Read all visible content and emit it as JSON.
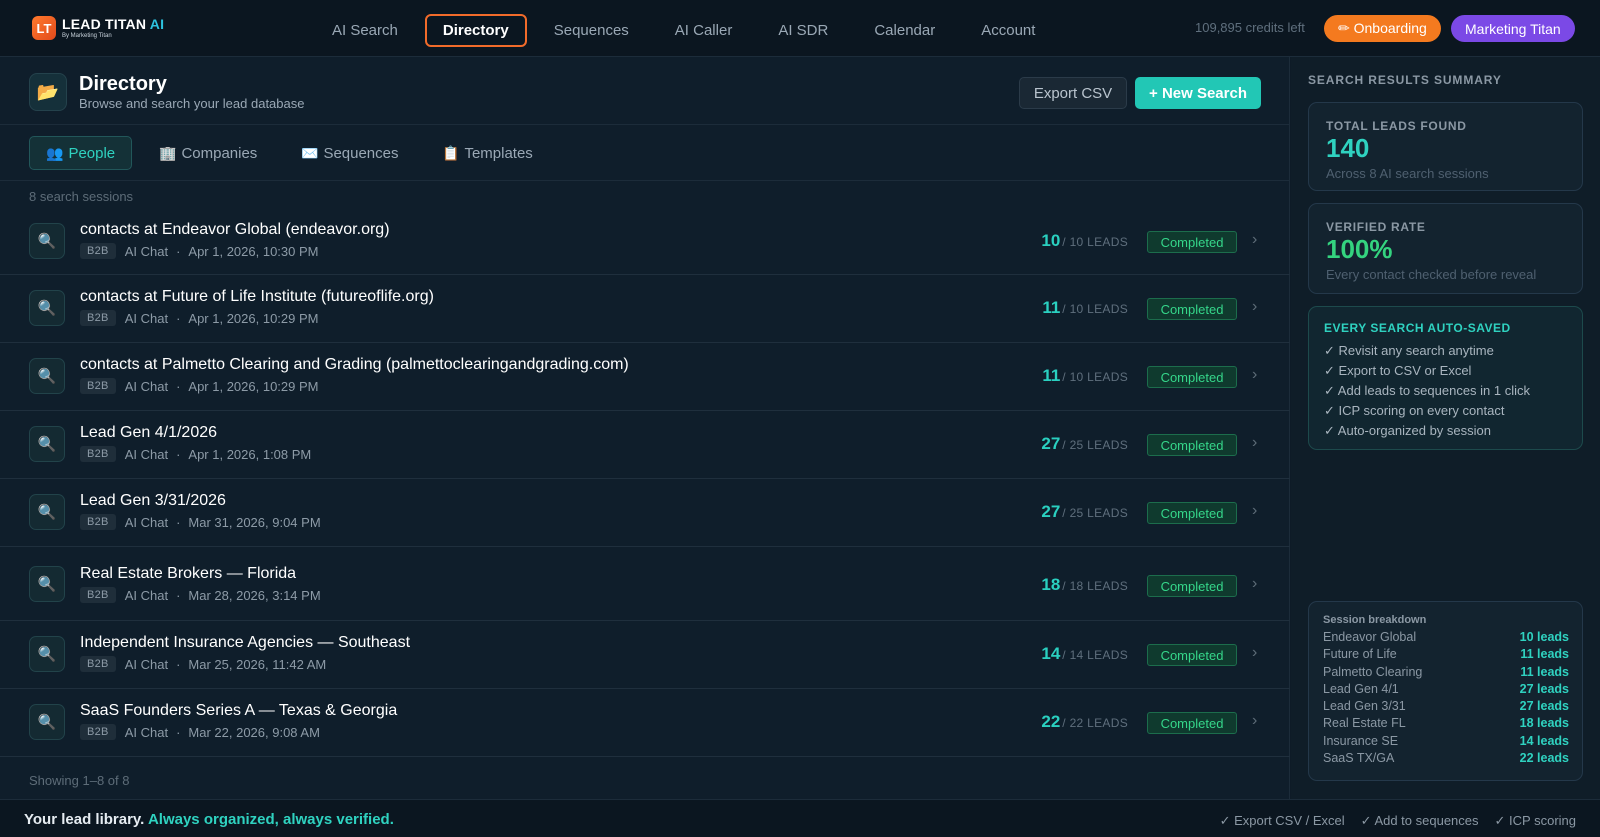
{
  "brand": {
    "logo_mark": "LT",
    "name_main": "LEAD TITAN",
    "name_accent": "AI",
    "tagline": "By Marketing Titan"
  },
  "nav": {
    "items": [
      {
        "label": "AI Search"
      },
      {
        "label": "Directory",
        "active": true
      },
      {
        "label": "Sequences"
      },
      {
        "label": "AI Caller"
      },
      {
        "label": "AI SDR"
      },
      {
        "label": "Calendar"
      },
      {
        "label": "Account"
      }
    ],
    "credits": "109,895 credits left",
    "onboarding_icon": "pencil-icon",
    "onboarding_label": "✏ Onboarding",
    "account_label": "Marketing Titan"
  },
  "header": {
    "icon": "folder-icon",
    "title": "Directory",
    "subtitle": "Browse and search your lead database",
    "export_label": "Export CSV",
    "new_search_label": "+ New Search"
  },
  "tabs": [
    {
      "icon": "👥",
      "label": "People",
      "active": true
    },
    {
      "icon": "🏢",
      "label": "Companies"
    },
    {
      "icon": "✉️",
      "label": "Sequences"
    },
    {
      "icon": "📋",
      "label": "Templates"
    }
  ],
  "sessions_count": "8 search sessions",
  "sessions": [
    {
      "title": "contacts at Endeavor Global (endeavor.org)",
      "tag": "B2B",
      "source": "AI Chat",
      "date": "Apr 1, 2026, 10:30 PM",
      "found": "10",
      "of": "/ 10 LEADS",
      "status": "Completed"
    },
    {
      "title": "contacts at Future of Life Institute (futureoflife.org)",
      "tag": "B2B",
      "source": "AI Chat",
      "date": "Apr 1, 2026, 10:29 PM",
      "found": "11",
      "of": "/ 10 LEADS",
      "status": "Completed"
    },
    {
      "title": "contacts at Palmetto Clearing and Grading (palmettoclearingandgrading.com)",
      "tag": "B2B",
      "source": "AI Chat",
      "date": "Apr 1, 2026, 10:29 PM",
      "found": "11",
      "of": "/ 10 LEADS",
      "status": "Completed"
    },
    {
      "title": "Lead Gen 4/1/2026",
      "tag": "B2B",
      "source": "AI Chat",
      "date": "Apr 1, 2026, 1:08 PM",
      "found": "27",
      "of": "/ 25 LEADS",
      "status": "Completed"
    },
    {
      "title": "Lead Gen 3/31/2026",
      "tag": "B2B",
      "source": "AI Chat",
      "date": "Mar 31, 2026, 9:04 PM",
      "found": "27",
      "of": "/ 25 LEADS",
      "status": "Completed"
    },
    {
      "title": "Real Estate Brokers — Florida",
      "tag": "B2B",
      "source": "AI Chat",
      "date": "Mar 28, 2026, 3:14 PM",
      "found": "18",
      "of": "/ 18 LEADS",
      "status": "Completed"
    },
    {
      "title": "Independent Insurance Agencies — Southeast",
      "tag": "B2B",
      "source": "AI Chat",
      "date": "Mar 25, 2026, 11:42 AM",
      "found": "14",
      "of": "/ 14 LEADS",
      "status": "Completed"
    },
    {
      "title": "SaaS Founders Series A — Texas & Georgia",
      "tag": "B2B",
      "source": "AI Chat",
      "date": "Mar 22, 2026, 9:08 AM",
      "found": "22",
      "of": "/ 22 LEADS",
      "status": "Completed"
    }
  ],
  "showing": "Showing 1–8 of 8",
  "summary": {
    "heading": "SEARCH RESULTS SUMMARY",
    "total": {
      "label": "TOTAL LEADS FOUND",
      "value": "140",
      "note": "Across 8 AI search sessions",
      "color": "#2fd2c0"
    },
    "verified": {
      "label": "VERIFIED RATE",
      "value": "100%",
      "note": "Every contact checked before reveal",
      "color": "#34d37f"
    },
    "autosave": {
      "title": "EVERY SEARCH AUTO-SAVED",
      "items": [
        "✓ Revisit any search anytime",
        "✓ Export to CSV or Excel",
        "✓ Add leads to sequences in 1 click",
        "✓ ICP scoring on every contact",
        "✓ Auto-organized by session"
      ]
    },
    "breakdown": {
      "title": "Session breakdown",
      "rows": [
        {
          "name": "Endeavor Global",
          "value": "10 leads"
        },
        {
          "name": "Future of Life",
          "value": "11 leads"
        },
        {
          "name": "Palmetto Clearing",
          "value": "11 leads"
        },
        {
          "name": "Lead Gen 4/1",
          "value": "27 leads"
        },
        {
          "name": "Lead Gen 3/31",
          "value": "27 leads"
        },
        {
          "name": "Real Estate FL",
          "value": "18 leads"
        },
        {
          "name": "Insurance SE",
          "value": "14 leads"
        },
        {
          "name": "SaaS TX/GA",
          "value": "22 leads"
        }
      ]
    }
  },
  "footer": {
    "lead_text": "Your lead library.",
    "accent_text": "Always organized, always verified.",
    "features": [
      "✓ Export CSV / Excel",
      "✓ Add to sequences",
      "✓ ICP scoring"
    ]
  }
}
